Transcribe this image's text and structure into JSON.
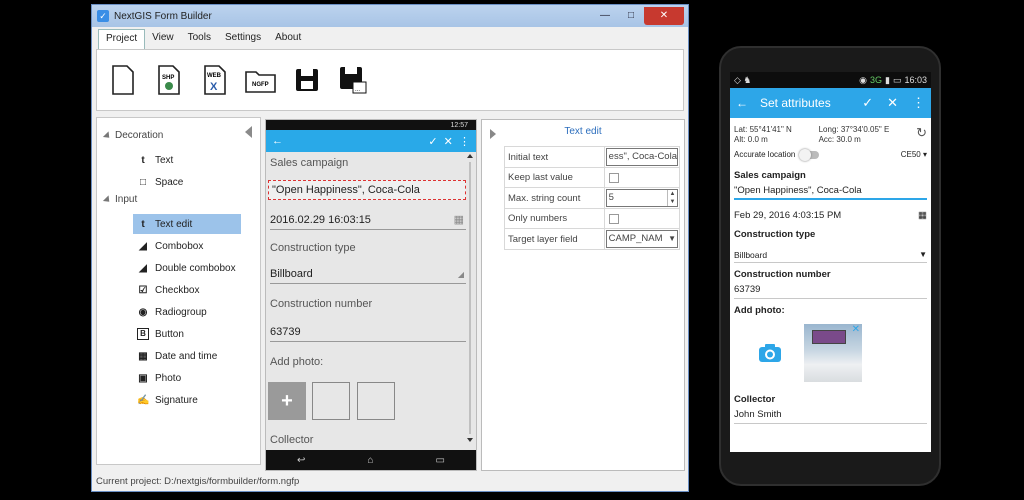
{
  "window": {
    "title": "NextGIS Form Builder",
    "controls": {
      "minimize": "—",
      "maximize": "□",
      "close": "✕"
    }
  },
  "menu": [
    "Project",
    "View",
    "Tools",
    "Settings",
    "About"
  ],
  "ribbon": {
    "icons": [
      "new-file",
      "shp-file",
      "web-file",
      "ngfp-folder",
      "save",
      "save-as"
    ],
    "labels": {
      "shp": "SHP",
      "web": "WEB",
      "ngfp": "NGFP"
    }
  },
  "tree": {
    "groups": {
      "decoration": "Decoration",
      "input": "Input"
    },
    "decoration_items": [
      {
        "label": "Text",
        "icon": "t"
      },
      {
        "label": "Space",
        "icon": "□"
      }
    ],
    "input_items": [
      {
        "label": "Text edit",
        "icon": "t"
      },
      {
        "label": "Combobox",
        "icon": "◢"
      },
      {
        "label": "Double combobox",
        "icon": "◢"
      },
      {
        "label": "Checkbox",
        "icon": "☑"
      },
      {
        "label": "Radiogroup",
        "icon": "◉"
      },
      {
        "label": "Button",
        "icon": "B"
      },
      {
        "label": "Date and time",
        "icon": "▦"
      },
      {
        "label": "Photo",
        "icon": "▣"
      },
      {
        "label": "Signature",
        "icon": "✍"
      }
    ]
  },
  "preview": {
    "status_time": "12:57",
    "fields": {
      "sales_campaign_label": "Sales campaign",
      "sales_campaign_value": "\"Open Happiness\", Coca-Cola",
      "date_value": "2016.02.29  16:03:15",
      "construction_type_label": "Construction type",
      "construction_type_value": "Billboard",
      "construction_number_label": "Construction number",
      "construction_number_value": "63739",
      "add_photo_label": "Add photo:",
      "collector_label": "Collector"
    }
  },
  "props": {
    "title": "Text edit",
    "rows": [
      {
        "label": "Initial text",
        "value": "ess\", Coca-Cola"
      },
      {
        "label": "Keep last value",
        "value": ""
      },
      {
        "label": "Max. string count",
        "value": "5"
      },
      {
        "label": "Only numbers",
        "value": ""
      },
      {
        "label": "Target layer field",
        "value": "CAMP_NAM"
      }
    ]
  },
  "statusbar": "Current project: D:/nextgis/formbuilder/form.ngfp",
  "phone": {
    "time": "16:03",
    "network": "3G",
    "toolbar_title": "Set attributes",
    "lat": "Lat: 55°41'41\" N",
    "alt": "Alt: 0.0 m",
    "long": "Long: 37°34'0.05\" E",
    "acc": "Acc: 30.0 m",
    "accurate_location": "Accurate location",
    "ce": "CE50",
    "sales_campaign_label": "Sales campaign",
    "sales_campaign_value": "\"Open Happiness\", Coca-Cola",
    "date_value": "Feb 29, 2016 4:03:15 PM",
    "construction_type_label": "Construction type",
    "construction_type_value": "Billboard",
    "construction_number_label": "Construction number",
    "construction_number_value": "63739",
    "add_photo_label": "Add photo:",
    "collector_label": "Collector",
    "collector_value": "John Smith"
  }
}
